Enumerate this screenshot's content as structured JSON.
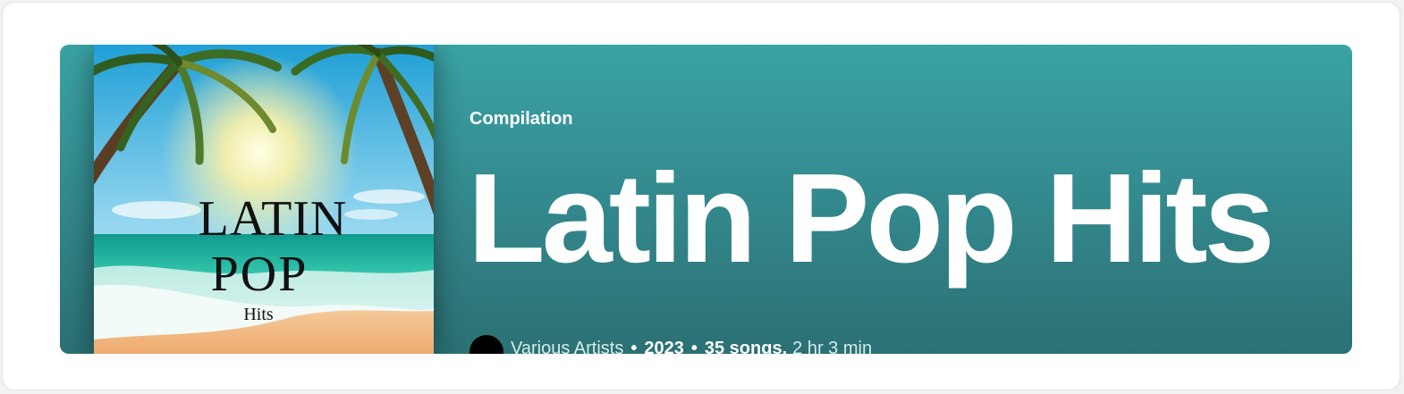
{
  "album": {
    "type_label": "Compilation",
    "title": "Latin Pop Hits",
    "cover": {
      "line1": "LATIN",
      "line2": "POP",
      "line3": "Hits"
    },
    "meta": {
      "artist": "Various Artists",
      "separator": "•",
      "year": "2023",
      "songs": "35 songs,",
      "duration": "2 hr 3 min"
    }
  },
  "colors": {
    "banner_top": "#3aa3a5",
    "banner_bottom": "#2b7074",
    "text": "#ffffff"
  }
}
